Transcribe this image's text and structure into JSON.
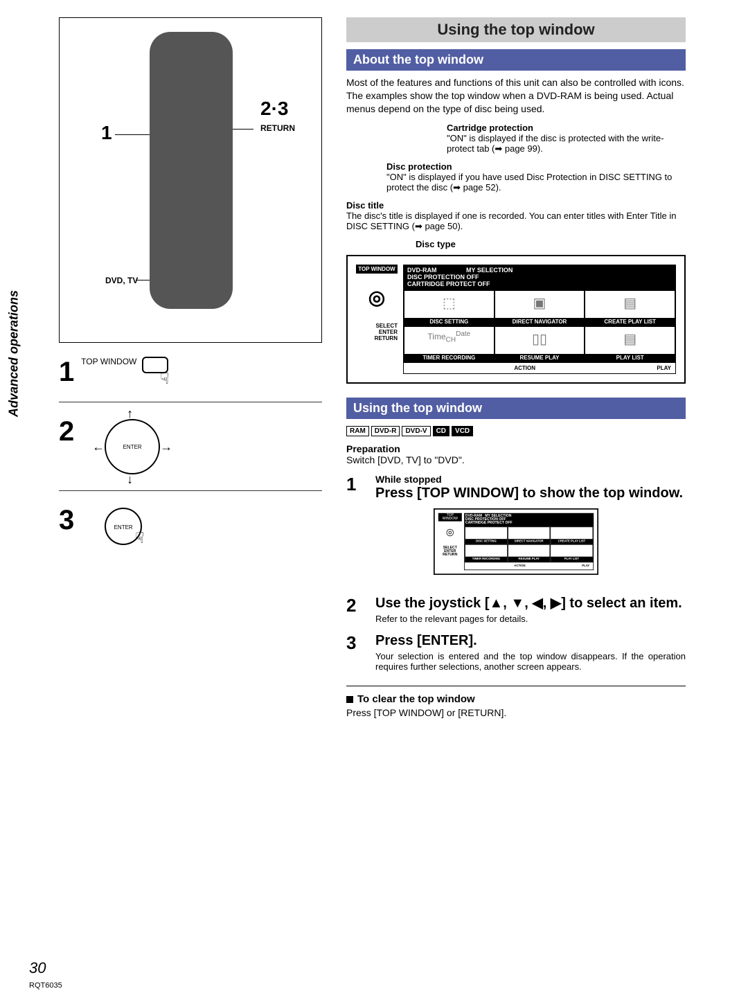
{
  "sideTab": "Advanced operations",
  "pageNum": "30",
  "docId": "RQT6035",
  "left": {
    "callout1": "1",
    "callout23": "2·3",
    "calloutReturn": "RETURN",
    "calloutDvdTv": "DVD, TV",
    "step1": {
      "num": "1",
      "label": "TOP WINDOW"
    },
    "step2": {
      "num": "2",
      "enter": "ENTER"
    },
    "step3": {
      "num": "3",
      "enter": "ENTER"
    }
  },
  "right": {
    "titleBand": "Using the top window",
    "subBand1": "About the top window",
    "intro": "Most of the features and functions of this unit can also be controlled with icons. The examples show the top window when a DVD-RAM is being used. Actual menus depend on the type of disc being used.",
    "ann": {
      "cartProt": {
        "title": "Cartridge protection",
        "text": "\"ON\" is displayed if the disc is protected with the write-protect tab (➡ page 99)."
      },
      "discProt": {
        "title": "Disc protection",
        "text": "\"ON\" is displayed if you have used Disc Protection in DISC SETTING to protect the disc (➡ page 52)."
      },
      "discTitle": {
        "title": "Disc title",
        "text": "The disc's title is displayed if one is recorded. You can enter titles with Enter Title in DISC SETTING (➡ page 50)."
      },
      "discType": {
        "title": "Disc type"
      }
    },
    "windowHeader": {
      "left": "DVD-RAM",
      "right": "MY SELECTION",
      "line2": "DISC PROTECTION OFF",
      "line3": "CARTRIDGE PROTECT OFF"
    },
    "topWindowLabel": "TOP WINDOW",
    "cells": {
      "r1c1": "DISC SETTING",
      "r1c2": "DIRECT NAVIGATOR",
      "r1c3": "CREATE PLAY LIST",
      "r2c1": "TIMER RECORDING",
      "r2c2": "RESUME PLAY",
      "r2c3": "PLAY LIST",
      "footerL": "ACTION",
      "footerR": "PLAY"
    },
    "selectEnterReturn": {
      "select": "SELECT",
      "enter": "ENTER",
      "return": "RETURN"
    },
    "subBand2": "Using the top window",
    "badges": [
      "RAM",
      "DVD-R",
      "DVD-V",
      "CD",
      "VCD"
    ],
    "prep": {
      "title": "Preparation",
      "text": "Switch [DVD, TV] to \"DVD\"."
    },
    "steps": {
      "s1": {
        "num": "1",
        "sub": "While stopped",
        "big": "Press [TOP WINDOW] to show the top window."
      },
      "s2": {
        "num": "2",
        "big": "Use the joystick [▲, ▼, ◀, ▶] to select an item.",
        "small": "Refer to the relevant pages for details."
      },
      "s3": {
        "num": "3",
        "big": "Press [ENTER].",
        "small": "Your selection is entered and the top window disappears. If the operation requires further selections, another screen appears."
      }
    },
    "clear": {
      "title": "To clear the top window",
      "text": "Press [TOP WINDOW] or [RETURN]."
    }
  }
}
